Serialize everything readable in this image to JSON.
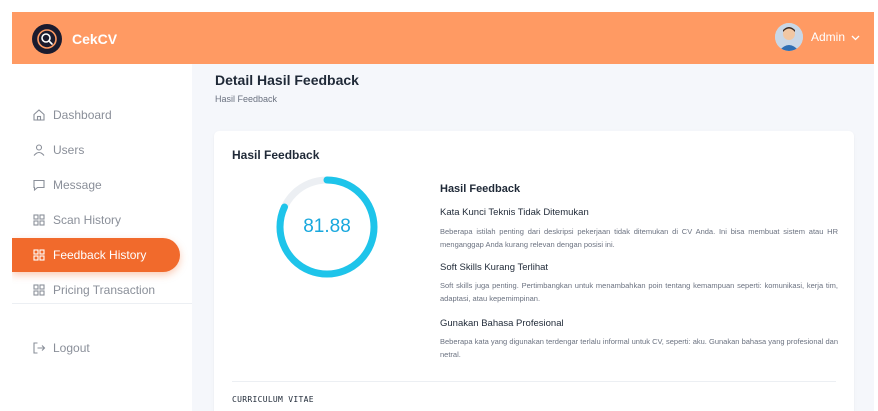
{
  "brand": {
    "name": "CekCV"
  },
  "user": {
    "name": "Admin"
  },
  "sidebar": {
    "items": [
      {
        "label": "Dashboard",
        "icon": "home-icon",
        "active": false
      },
      {
        "label": "Users",
        "icon": "user-icon",
        "active": false
      },
      {
        "label": "Message",
        "icon": "message-icon",
        "active": false
      },
      {
        "label": "Scan History",
        "icon": "grid-icon",
        "active": false
      },
      {
        "label": "Feedback History",
        "icon": "grid-icon",
        "active": true
      },
      {
        "label": "Pricing Transaction",
        "icon": "grid-icon",
        "active": false
      }
    ],
    "logout_label": "Logout"
  },
  "page": {
    "title": "Detail Hasil Feedback",
    "breadcrumb": "Hasil Feedback"
  },
  "card": {
    "title": "Hasil Feedback",
    "score": "81.88",
    "score_fraction": 0.8188,
    "feedback_title": "Hasil Feedback",
    "items": [
      {
        "heading": "Kata Kunci Teknis Tidak Ditemukan",
        "text": "Beberapa istilah penting dari deskripsi pekerjaan tidak ditemukan di CV Anda. Ini bisa membuat sistem atau HR menganggap Anda kurang relevan dengan posisi ini."
      },
      {
        "heading": "Soft Skills Kurang Terlihat",
        "text": "Soft skills juga penting. Pertimbangkan untuk menambahkan poin tentang kemampuan seperti: komunikasi, kerja tim, adaptasi, atau kepemimpinan."
      },
      {
        "heading": "Gunakan Bahasa Profesional",
        "text": "Beberapa kata yang digunakan terdengar terlalu informal untuk CV, seperti: aku. Gunakan bahasa yang profesional dan netral."
      }
    ],
    "cv_heading": "CURRICULUM VITAE"
  },
  "colors": {
    "header": "#ff9a63",
    "active_nav": "#f16a2c",
    "gauge": "#1ec4ea",
    "gauge_track": "#eceff3",
    "score_text": "#19a8dd"
  }
}
